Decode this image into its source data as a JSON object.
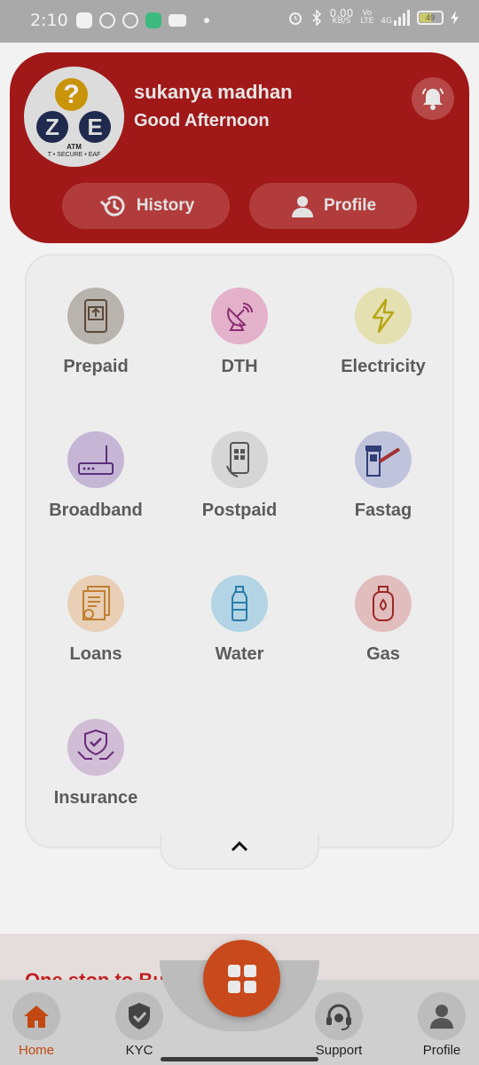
{
  "status_bar": {
    "time": "2:10",
    "net_speed_value": "0.00",
    "net_speed_unit": "KB/S",
    "volte_top": "Vo",
    "volte_bottom": "LTE",
    "network": "4G",
    "battery": "49"
  },
  "header": {
    "logo": {
      "letter_top": "?",
      "letter_left": "Z",
      "letter_right": "E",
      "atm": "ATM",
      "tagline": "T • SECURE • EAF"
    },
    "user_name": "sukanya madhan",
    "greeting": "Good Afternoon",
    "history_label": "History",
    "profile_label": "Profile"
  },
  "services": [
    {
      "label": "Prepaid",
      "icon": "mobile-recharge-icon",
      "bg": "#b9b3ad"
    },
    {
      "label": "DTH",
      "icon": "satellite-dish-icon",
      "bg": "#e3b1c9"
    },
    {
      "label": "Electricity",
      "icon": "lightning-icon",
      "bg": "#e4e0b2"
    },
    {
      "label": "Broadband",
      "icon": "router-icon",
      "bg": "#c6b6d5"
    },
    {
      "label": "Postpaid",
      "icon": "smartphone-icon",
      "bg": "#d6d6d6"
    },
    {
      "label": "Fastag",
      "icon": "toll-gate-icon",
      "bg": "#c0c3dc"
    },
    {
      "label": "Loans",
      "icon": "document-icon",
      "bg": "#e8cfb6"
    },
    {
      "label": "Water",
      "icon": "water-bottle-icon",
      "bg": "#b2d4e4"
    },
    {
      "label": "Gas",
      "icon": "gas-cylinder-icon",
      "bg": "#e2bdbd"
    },
    {
      "label": "Insurance",
      "icon": "shield-hands-icon",
      "bg": "#d1bdd6"
    }
  ],
  "banner_text": "One stop to Business...",
  "bottom_nav": {
    "home": "Home",
    "kyc": "KYC",
    "support": "Support",
    "profile": "Profile"
  },
  "colors": {
    "brand_red": "#a01818",
    "accent_orange": "#c84a1c"
  }
}
